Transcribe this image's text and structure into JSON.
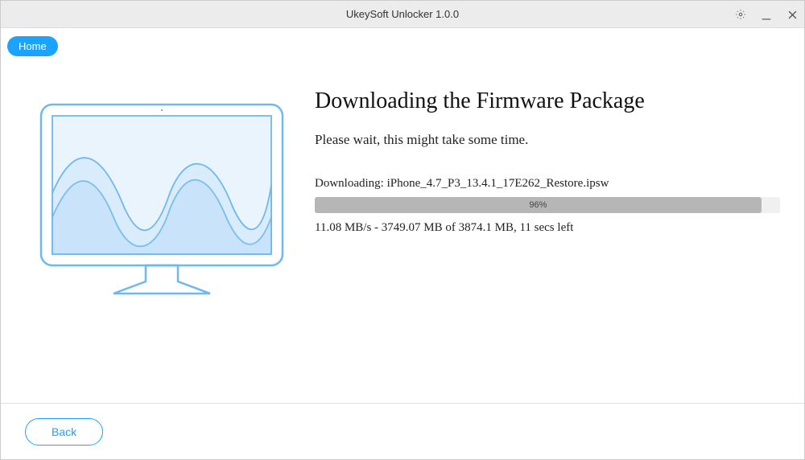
{
  "window": {
    "title": "UkeySoft Unlocker 1.0.0"
  },
  "tabs": {
    "home_label": "Home"
  },
  "main": {
    "heading": "Downloading the Firmware Package",
    "subtext": "Please wait, this might take some time.",
    "downloading_prefix": "Downloading: ",
    "downloading_file": "iPhone_4.7_P3_13.4.1_17E262_Restore.ipsw",
    "progress_percent": 96,
    "progress_label": "96%",
    "stats": "11.08 MB/s - 3749.07 MB of 3874.1 MB, 11 secs left"
  },
  "footer": {
    "back_label": "Back"
  },
  "colors": {
    "accent": "#1aa3ff",
    "illus_stroke": "#6fb8ef",
    "illus_fill": "#d8ecfb",
    "progress_fill": "#b6b6b6"
  }
}
